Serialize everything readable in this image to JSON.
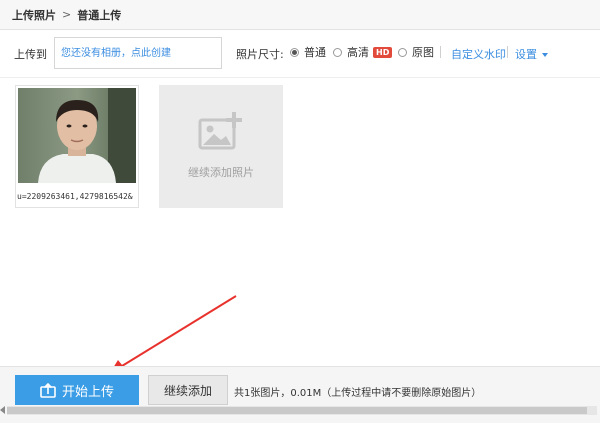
{
  "breadcrumb": {
    "root": "上传照片",
    "separator": ">",
    "current": "普通上传"
  },
  "toolbar": {
    "upload_to_label": "上传到",
    "album_placeholder": "您还没有相册，点此创建",
    "size_label": "照片尺寸:",
    "size_options": [
      {
        "label": "普通",
        "selected": true
      },
      {
        "label": "高清",
        "badge": "HD",
        "selected": false
      },
      {
        "label": "原图",
        "selected": false
      }
    ],
    "watermark_link": "自定义水印",
    "settings_link": "设置"
  },
  "photos": [
    {
      "filename": "u=2209263461,4279816542&"
    }
  ],
  "add_tile": {
    "label": "继续添加照片"
  },
  "footer": {
    "start_button": "开始上传",
    "continue_button": "继续添加",
    "summary": "共1张图片，0.01M（上传过程中请不要删除原始图片）"
  },
  "colors": {
    "accent": "#3a9de6",
    "link": "#3a8de0",
    "hd_badge": "#e24a3b",
    "annotation_arrow": "#e8322d"
  }
}
